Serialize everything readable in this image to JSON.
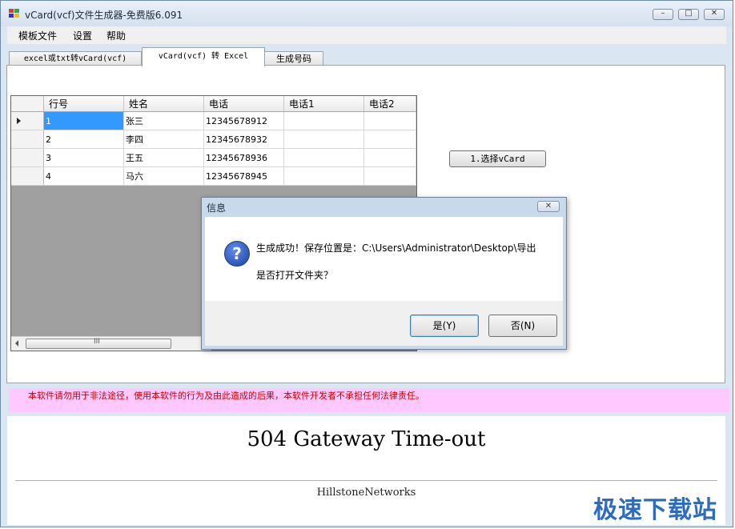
{
  "window": {
    "title": "vCard(vcf)文件生成器-免费版6.091",
    "min_glyph": "–",
    "max_glyph": "□",
    "close_glyph": "✕"
  },
  "menu": [
    "模板文件",
    "设置",
    "帮助"
  ],
  "tabs": [
    {
      "label": "excel或txt转vCard(vcf)",
      "active": false
    },
    {
      "label": "vCard(vcf) 转 Excel",
      "active": true
    },
    {
      "label": "生成号码",
      "active": false
    }
  ],
  "grid": {
    "columns": [
      "行号",
      "姓名",
      "电话",
      "电话1",
      "电话2"
    ],
    "rows": [
      [
        "1",
        "张三",
        "12345678912",
        "",
        ""
      ],
      [
        "2",
        "李四",
        "12345678932",
        "",
        ""
      ],
      [
        "3",
        "王五",
        "12345678936",
        "",
        ""
      ],
      [
        "4",
        "马六",
        "12345678945",
        "",
        ""
      ]
    ],
    "scroll_glyph": "III"
  },
  "select_button": "1.选择vCard",
  "dialog": {
    "title": "信息",
    "close_glyph": "✕",
    "icon_glyph": "?",
    "line1": "生成成功！保存位置是：C:\\Users\\Administrator\\Desktop\\导出",
    "line2": "是否打开文件夹？",
    "yes_label": "是(Y)",
    "no_label": "否(N)"
  },
  "disclaimer": "本软件请勿用于非法途径，使用本软件的行为及由此造成的后果，本软件开发者不承担任何法律责任。",
  "error_page": {
    "title": "504 Gateway Time-out",
    "footer": "HillstoneNetworks"
  },
  "watermark": "极速下载站",
  "colors": {
    "selection": "#3399ff",
    "disclaimer_bg": "#ffc9ff",
    "disclaimer_text": "#cc0000",
    "watermark": "#2c6cbf"
  }
}
